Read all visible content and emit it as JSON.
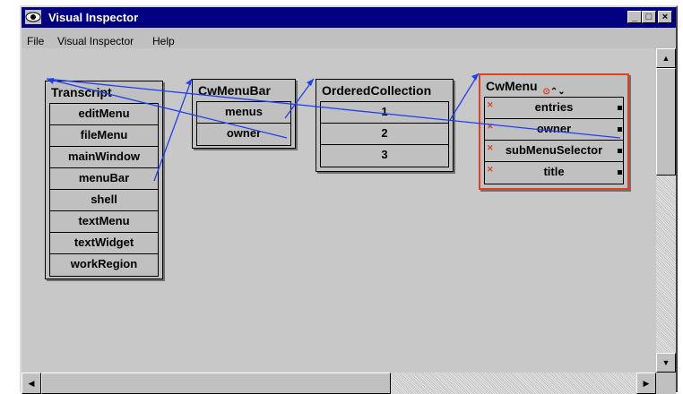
{
  "window": {
    "title": "Visual Inspector"
  },
  "menu": [
    "File",
    "Visual Inspector",
    "Help"
  ],
  "objects": [
    {
      "title": "Transcript",
      "slots": [
        "editMenu",
        "fileMenu",
        "mainWindow",
        "menuBar",
        "shell",
        "textMenu",
        "textWidget",
        "workRegion"
      ]
    },
    {
      "title": "CwMenuBar",
      "slots": [
        "menus",
        "owner"
      ]
    },
    {
      "title": "OrderedCollection",
      "slots": [
        "1",
        "2",
        "3"
      ]
    },
    {
      "title": "CwMenu",
      "slots": [
        "entries",
        "owner",
        "subMenuSelector",
        "title"
      ],
      "selected": true
    }
  ],
  "colors": {
    "titlebar": "#000080",
    "selection": "#e04020",
    "link": "#1f3ff0"
  },
  "icons": [
    "eye-icon",
    "minimize-icon",
    "maximize-icon",
    "close-icon",
    "scroll-up-icon",
    "scroll-down-icon",
    "scroll-left-icon",
    "scroll-right-icon"
  ]
}
